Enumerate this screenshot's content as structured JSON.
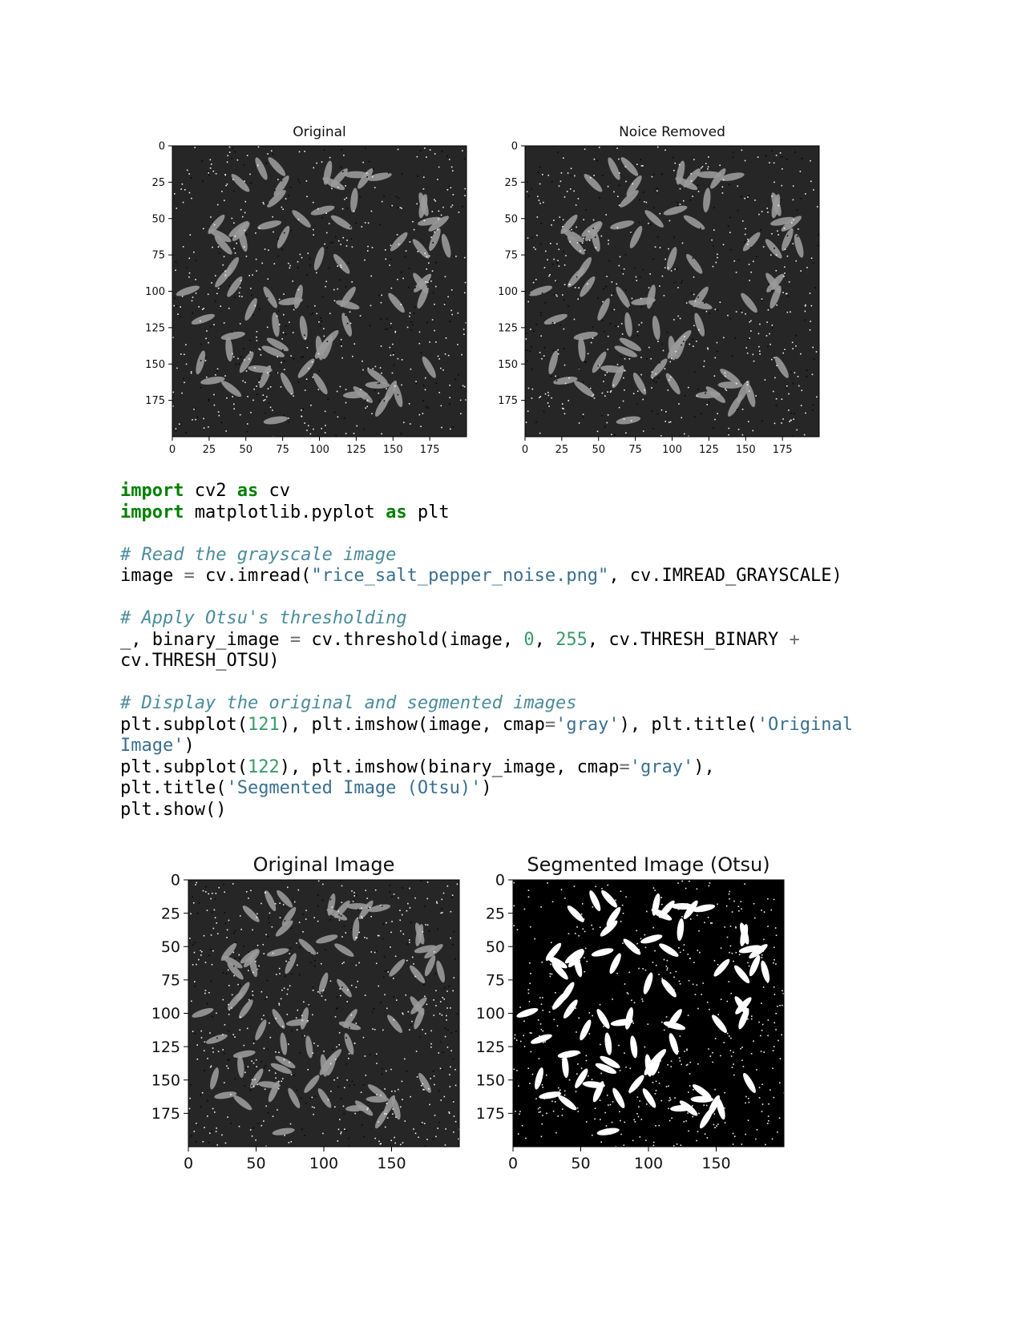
{
  "figures": [
    {
      "id": "top",
      "panels": [
        {
          "title": "Original",
          "style": "gray",
          "y_ticks": [
            "0",
            "25",
            "50",
            "75",
            "100",
            "125",
            "150",
            "175"
          ],
          "x_ticks": [
            "0",
            "25",
            "50",
            "75",
            "100",
            "125",
            "150",
            "175"
          ]
        },
        {
          "title": "Noice Removed",
          "style": "gray",
          "y_ticks": [
            "0",
            "25",
            "50",
            "75",
            "100",
            "125",
            "150",
            "175"
          ],
          "x_ticks": [
            "0",
            "25",
            "50",
            "75",
            "100",
            "125",
            "150",
            "175"
          ]
        }
      ]
    },
    {
      "id": "bottom",
      "panels": [
        {
          "title": "Original Image",
          "style": "gray",
          "y_ticks": [
            "0",
            "25",
            "50",
            "75",
            "100",
            "125",
            "150",
            "175"
          ],
          "x_ticks": [
            "0",
            "50",
            "100",
            "150"
          ]
        },
        {
          "title": "Segmented Image (Otsu)",
          "style": "binary",
          "y_ticks": [
            "0",
            "25",
            "50",
            "75",
            "100",
            "125",
            "150",
            "175"
          ],
          "x_ticks": [
            "0",
            "50",
            "100",
            "150"
          ]
        }
      ]
    }
  ],
  "code": {
    "lines": [
      [
        [
          "kw",
          "import"
        ],
        [
          "t",
          " cv2 "
        ],
        [
          "kw",
          "as"
        ],
        [
          "t",
          " cv"
        ]
      ],
      [
        [
          "kw",
          "import"
        ],
        [
          "t",
          " matplotlib.pyplot "
        ],
        [
          "kw",
          "as"
        ],
        [
          "t",
          " plt"
        ]
      ],
      [],
      [
        [
          "cm",
          "# Read the grayscale image"
        ]
      ],
      [
        [
          "t",
          "image "
        ],
        [
          "op",
          "="
        ],
        [
          "t",
          " cv.imread("
        ],
        [
          "st",
          "\"rice_salt_pepper_noise.png\""
        ],
        [
          "t",
          ", cv.IMREAD_GRAYSCALE)"
        ]
      ],
      [],
      [
        [
          "cm",
          "# Apply Otsu's thresholding"
        ]
      ],
      [
        [
          "t",
          "_, binary_image "
        ],
        [
          "op",
          "="
        ],
        [
          "t",
          " cv.threshold(image, "
        ],
        [
          "nm",
          "0"
        ],
        [
          "t",
          ", "
        ],
        [
          "nm",
          "255"
        ],
        [
          "t",
          ", cv.THRESH_BINARY "
        ],
        [
          "op",
          "+"
        ]
      ],
      [
        [
          "t",
          "cv.THRESH_OTSU)"
        ]
      ],
      [],
      [
        [
          "cm",
          "# Display the original and segmented images"
        ]
      ],
      [
        [
          "t",
          "plt.subplot("
        ],
        [
          "nm",
          "121"
        ],
        [
          "t",
          "), plt.imshow(image, cmap"
        ],
        [
          "op",
          "="
        ],
        [
          "st",
          "'gray'"
        ],
        [
          "t",
          "), plt.title("
        ],
        [
          "st",
          "'Original"
        ]
      ],
      [
        [
          "st",
          "Image'"
        ],
        [
          "t",
          ")"
        ]
      ],
      [
        [
          "t",
          "plt.subplot("
        ],
        [
          "nm",
          "122"
        ],
        [
          "t",
          "), plt.imshow(binary_image, cmap"
        ],
        [
          "op",
          "="
        ],
        [
          "st",
          "'gray'"
        ],
        [
          "t",
          "),"
        ]
      ],
      [
        [
          "t",
          "plt.title("
        ],
        [
          "st",
          "'Segmented Image (Otsu)'"
        ],
        [
          "t",
          ")"
        ]
      ],
      [
        [
          "t",
          "plt.show()"
        ]
      ]
    ]
  },
  "colors": {
    "keyword": "#008000",
    "comment": "#4b8c9a",
    "string": "#3a6f8f",
    "number": "#3a9a6a"
  }
}
